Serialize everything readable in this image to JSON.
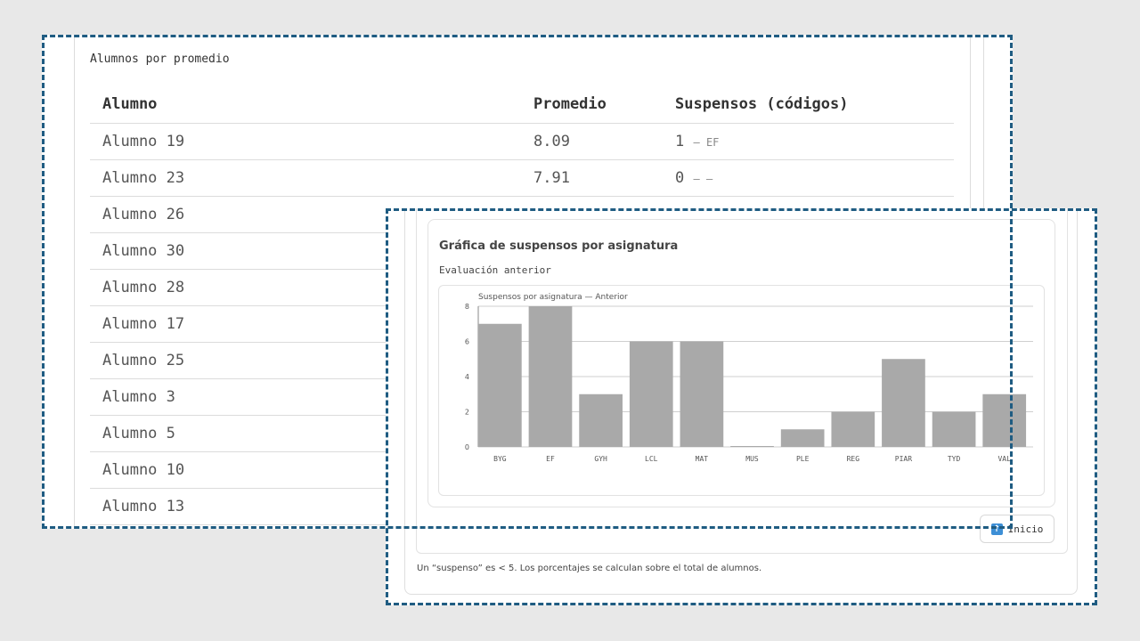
{
  "table": {
    "title": "Alumnos por promedio",
    "headers": [
      "Alumno",
      "Promedio",
      "Suspensos (códigos)"
    ],
    "rows": [
      {
        "name": "Alumno 19",
        "avg": "8.09",
        "fails": "1",
        "codes": "– EF"
      },
      {
        "name": "Alumno 23",
        "avg": "7.91",
        "fails": "0",
        "codes": "– –"
      },
      {
        "name": "Alumno 26",
        "avg": "",
        "fails": "",
        "codes": ""
      },
      {
        "name": "Alumno 30",
        "avg": "",
        "fails": "",
        "codes": ""
      },
      {
        "name": "Alumno 28",
        "avg": "",
        "fails": "",
        "codes": ""
      },
      {
        "name": "Alumno 17",
        "avg": "",
        "fails": "",
        "codes": ""
      },
      {
        "name": "Alumno 25",
        "avg": "",
        "fails": "",
        "codes": ""
      },
      {
        "name": "Alumno 3",
        "avg": "",
        "fails": "",
        "codes": ""
      },
      {
        "name": "Alumno 5",
        "avg": "",
        "fails": "",
        "codes": ""
      },
      {
        "name": "Alumno 10",
        "avg": "",
        "fails": "",
        "codes": ""
      },
      {
        "name": "Alumno 13",
        "avg": "",
        "fails": "",
        "codes": ""
      }
    ]
  },
  "chart_section": {
    "heading": "Gráfica de suspensos por asignatura",
    "subheading": "Evaluación anterior"
  },
  "chart_data": {
    "type": "bar",
    "title": "Suspensos por asignatura — Anterior",
    "categories": [
      "BYG",
      "EF",
      "GYH",
      "LCL",
      "MAT",
      "MUS",
      "PLE",
      "REG",
      "PIAR",
      "TYD",
      "VAL"
    ],
    "values": [
      7,
      8,
      3,
      6,
      6,
      0,
      1,
      2,
      5,
      2,
      3
    ],
    "ylim": [
      0,
      8
    ],
    "yticks": [
      0,
      2,
      4,
      6,
      8
    ],
    "grid": true,
    "bar_color": "#a9a9a9"
  },
  "buttons": {
    "inicio_label": "Inicio",
    "inicio_icon": "arrow-up-icon"
  },
  "footnote": "Un “suspenso” es < 5. Los porcentajes se calculan sobre el total de alumnos.",
  "colors": {
    "frame": "#1f5c82",
    "accent": "#3d8fd6"
  }
}
